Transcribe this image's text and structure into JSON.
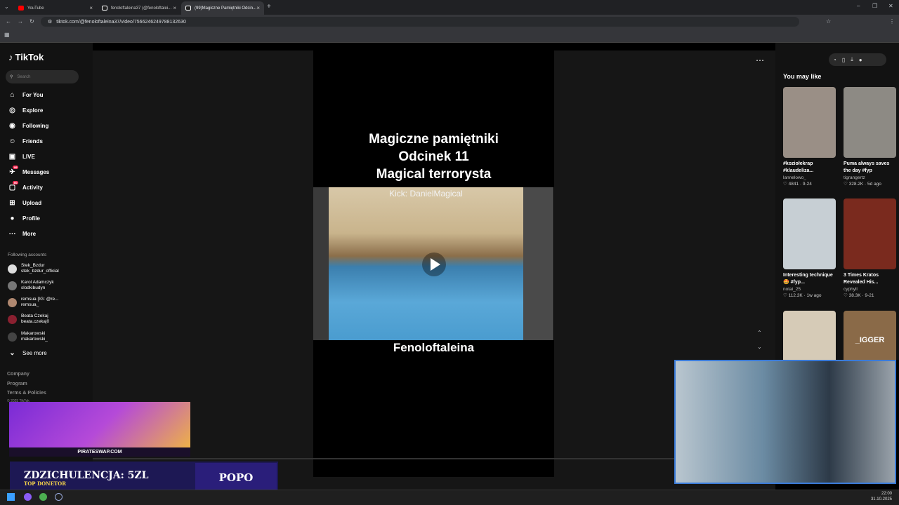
{
  "browser": {
    "tabs": [
      {
        "title": "YouTube",
        "favicon_color": "#ff0000"
      },
      {
        "title": "fenoloftaleina37 (@fenoloftalei...",
        "favicon_color": "#ffffff"
      },
      {
        "title": "(99)Magiczne Pamiętniki Odcin...",
        "favicon_color": "#ffffff"
      }
    ],
    "url": "tiktok.com/@fenoloftaleina37/video/7566246249788132630",
    "new_tab_label": "+"
  },
  "tiktok": {
    "logo_text": "TikTok",
    "search_placeholder": "Search",
    "nav": [
      {
        "label": "For You",
        "icon": "home-icon"
      },
      {
        "label": "Explore",
        "icon": "compass-icon"
      },
      {
        "label": "Following",
        "icon": "following-icon"
      },
      {
        "label": "Friends",
        "icon": "friends-icon"
      },
      {
        "label": "LIVE",
        "icon": "live-icon"
      },
      {
        "label": "Messages",
        "icon": "messages-icon",
        "badge": "99"
      },
      {
        "label": "Activity",
        "icon": "activity-icon",
        "badge": "60"
      },
      {
        "label": "Upload",
        "icon": "upload-icon"
      },
      {
        "label": "Profile",
        "icon": "profile-icon"
      },
      {
        "label": "More",
        "icon": "more-icon"
      }
    ],
    "following_heading": "Following accounts",
    "following_accounts": [
      {
        "name": "Stek_Bzdur",
        "handle": "stek_bzdur_official"
      },
      {
        "name": "Karol Adamczyk",
        "handle": "slodkibudyn"
      },
      {
        "name": "remsua [IG: @re...",
        "handle": "remsua_"
      },
      {
        "name": "Beata Czekaj",
        "handle": "beata.czekaj0"
      },
      {
        "name": "Makarowski",
        "handle": "makarowski_"
      }
    ],
    "see_more": "See more",
    "footer": [
      "Company",
      "Program",
      "Terms & Policies"
    ],
    "copyright": "© 2025 TikTok"
  },
  "video": {
    "title_lines": [
      "Magiczne pamiętniki",
      "Odcinek 11",
      "Magical terrorysta"
    ],
    "overlay_text": "Kick: DanielMagical",
    "caption": "Fenoloftaleina"
  },
  "recommend": {
    "heading": "You may like",
    "items": [
      {
        "caption": "#koziołekrap #klaudeliza...",
        "author": "lannelowo_",
        "likes": "4841",
        "date": "9-24",
        "thumb_color": "#9a8f86"
      },
      {
        "caption": "Puma always saves the day #fyp",
        "author": "tigrangertz",
        "likes": "328.2K",
        "date": "5d ago",
        "thumb_color": "#8d8a84"
      },
      {
        "caption": "Interesting technique 🤩 #fyp...",
        "author": "notai_25",
        "likes": "112.3K",
        "date": "1w ago",
        "thumb_color": "#c7cfd4"
      },
      {
        "caption": "3 Times Kratos Revealed His...",
        "author": "cyphyll",
        "likes": "38.3K",
        "date": "9-21",
        "thumb_color": "#7a2a1e"
      },
      {
        "caption": "",
        "author": "",
        "likes": "",
        "date": "",
        "thumb_color": "#d6cbb7"
      },
      {
        "caption": "",
        "author": "",
        "likes": "",
        "date": "",
        "thumb_color": "#8a6a48",
        "overlay": "_IGGER"
      }
    ]
  },
  "stream": {
    "ad_caption": "PIRATESWAP.COM",
    "donation_line": "ZDZICHULENCJA: 5ZL",
    "donation_sub": "TOP DONETOR",
    "donation_right": "POPO"
  },
  "clock": {
    "time": "22:00",
    "date": "31.10.2025"
  }
}
